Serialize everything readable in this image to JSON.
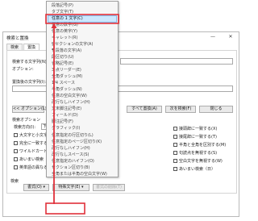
{
  "dialog": {
    "title": "検索と置換",
    "min_glyph": "—",
    "close_glyph": "✕",
    "tabs": [
      {
        "label": "検索"
      },
      {
        "label": "置換"
      }
    ],
    "find_label": "検索する文字列(N):",
    "options_label": "オプション:",
    "replace_label": "置換後の文字列(I):",
    "less_button": "<< オプション(L)",
    "replace_all_button": "すべて置換(A)",
    "find_next_button": "次を検索(F)",
    "close_button": "閉じる",
    "search_options_label": "検索オプション",
    "direction_label": "検索方向(I):",
    "direction_value": "下へ",
    "left_checks": [
      {
        "label": "大文字と小文字を区別"
      },
      {
        "label": "完全に一致する単語"
      },
      {
        "label": "ワイルドカードを使用"
      },
      {
        "label": "あいまい検索（英）"
      },
      {
        "label": "英単語の異なる活用形"
      }
    ],
    "right_checks": [
      {
        "label": "接頭辞に一致する(X)"
      },
      {
        "label": "接尾辞に一致する(T)"
      },
      {
        "label": "半角と全角を区別する(M)"
      },
      {
        "label": "句読点を無視する(S)"
      },
      {
        "label": "空白文字を無視する(W)"
      },
      {
        "label": "あいまい検索（日）"
      }
    ],
    "find_section_label": "検索",
    "format_button": "書式(O) ▾",
    "special_button": "特殊文字(E) ▾",
    "no_format_button": "書式の削除(T)"
  },
  "menu": {
    "items": [
      "段落記号(P)",
      "タブ文字(T)",
      "任意の 1 文字(C)",
      "任意の数字(G)",
      "任意の英字(Y)",
      "キャレット(R)",
      "§ セクションの文字(A)",
      "¶ 段落の文字(A)",
      "段区切り(U)",
      "省略記号(E)",
      "3 点リーダー(E)",
      "全角ダッシュ(M)",
      "1/4 スペース",
      "半角ダッシュ(N)",
      "任意の空白文字(W)",
      "改行なしハイフン(H)",
      "文末脚注記号(E)",
      "フィールド(D)",
      "脚注記号(F)",
      "グラフィック(I)",
      "任意指定の行区切り(L)",
      "任意指定のページ区切り(K)",
      "改行なしハイフン(H)",
      "改行なしスペース(S)",
      "任意指定のハイフン(O)",
      "セクション区切り(B)",
      "全角または半角の空白文字(W)"
    ],
    "highlighted_index": 2
  },
  "highlight_color": "#e0303a"
}
